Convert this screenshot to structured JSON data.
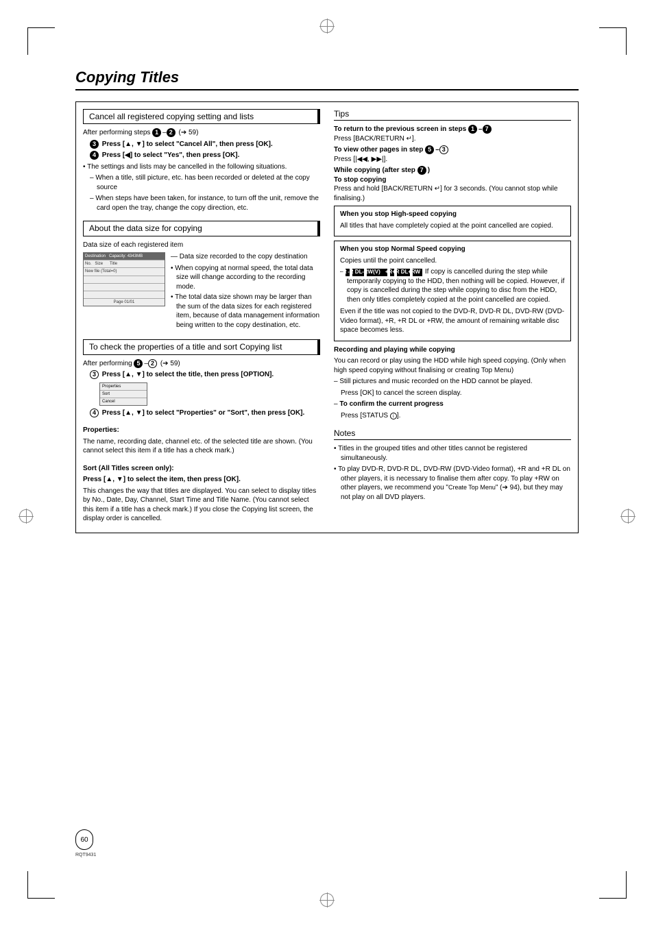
{
  "title": "Copying Titles",
  "left": {
    "sec1": {
      "header": "Cancel all registered copying setting and lists",
      "after": "After performing steps ",
      "after_ref": " (➔ 59)",
      "step3": "Press [▲, ▼] to select \"Cancel All\", then press [OK].",
      "step4": "Press [◀] to select \"Yes\", then press [OK].",
      "bullet": "The settings and lists may be cancelled in the following situations.",
      "sub1": "When a title, still picture, etc. has been recorded or deleted at the copy source",
      "sub2": "When steps have been taken, for instance, to turn off the unit, remove the card open the tray, change the copy direction, etc."
    },
    "sec2": {
      "header": "About the data size for copying",
      "intro": "Data size of each registered item",
      "table": {
        "dest": "Destination",
        "cap": "Capacity: 4343MB",
        "no": "No.",
        "size": "Size",
        "title": "Title",
        "new": "New file (Total=0)",
        "page": "Page 01/01"
      },
      "annot1": "Data size recorded to the copy destination",
      "b1": "When copying at normal speed, the total data size will change according to the recording mode.",
      "b2": "The total data size shown may be larger than the sum of the data sizes for each registered item, because of data management information being written to the copy destination, etc."
    },
    "sec3": {
      "header": "To check the properties of a title and sort Copying list",
      "after": "After performing ",
      "after_ref": " (➔ 59)",
      "step3": "Press [▲, ▼] to select the title, then press [OPTION].",
      "opt1": "Properties",
      "opt2": "Sort",
      "opt3": "Cancel",
      "step4": "Press [▲, ▼] to select \"Properties\" or \"Sort\", then press [OK].",
      "props_h": "Properties:",
      "props_t": "The name, recording date, channel etc. of the selected title are shown. (You cannot select this item if a title has a check mark.)",
      "sort_h": "Sort (All Titles screen only):",
      "sort_l": "Press [▲, ▼] to select the item, then press [OK].",
      "sort_t": "This changes the way that titles are displayed. You can select to display titles by No., Date, Day, Channel, Start Time and Title Name. (You cannot select this item if a title has a check mark.) If you close the Copying list screen, the display order is cancelled."
    }
  },
  "right": {
    "tips_h": "Tips",
    "t1a": "To return to the previous screen in steps ",
    "t1b": "Press [BACK/RETURN ",
    "t1c": "].",
    "t2a": "To view other pages in step ",
    "t2b": "Press [|◀◀, ▶▶|].",
    "t3a": "While copying (after step ",
    "t3b": ")",
    "t3c": "To stop copying",
    "t3d": "Press and hold [BACK/RETURN ",
    "t3e": "] for 3 seconds. (You cannot stop while finalising.)",
    "box1_h": "When you stop High-speed copying",
    "box1_t": "All titles that have completely copied at the point cancelled are copied.",
    "box2_h": "When you stop Normal Speed copying",
    "box2_t": "Copies until the point cancelled.",
    "box2_tag_after": " If copy is cancelled during the step while temporarily copying to the HDD, then nothing will be copied. However, if copy is cancelled during the step while copying to disc from the HDD, then only titles completely copied at the point cancelled are copied.",
    "box2_note": "Even if the title was not copied to the DVD-R, DVD-R DL, DVD-RW (DVD-Video format), +R, +R DL or +RW, the amount of remaining writable disc space becomes less.",
    "rec_h": "Recording and playing while copying",
    "rec_t1": "You can record or play using the HDD while high speed copying. (Only when high speed copying without finalising or creating Top Menu)",
    "rec_b1a": "Still pictures and music recorded on the HDD cannot be played.",
    "rec_b1b": "Press [OK] to cancel the screen display.",
    "rec_b2a": "To confirm the current progress",
    "rec_b2b": "Press [STATUS ",
    "rec_b2c": "].",
    "notes_h": "Notes",
    "n1": "Titles in the grouped titles and other titles cannot be registered simultaneously.",
    "n2a": "To play DVD-R, DVD-R DL, DVD-RW (DVD-Video format), +R and +R DL on other players, it is necessary to finalise them after copy. To play +RW on other players, we recommend you \"",
    "n2b": "Create Top Menu",
    "n2c": "\" (➔ 94), but they may not play on all DVD players."
  },
  "tags": [
    "-R",
    "-R DL",
    "-RW(V)",
    "+R",
    "+R DL",
    "+RW"
  ],
  "page_num": "60",
  "rqt": "RQT9431"
}
